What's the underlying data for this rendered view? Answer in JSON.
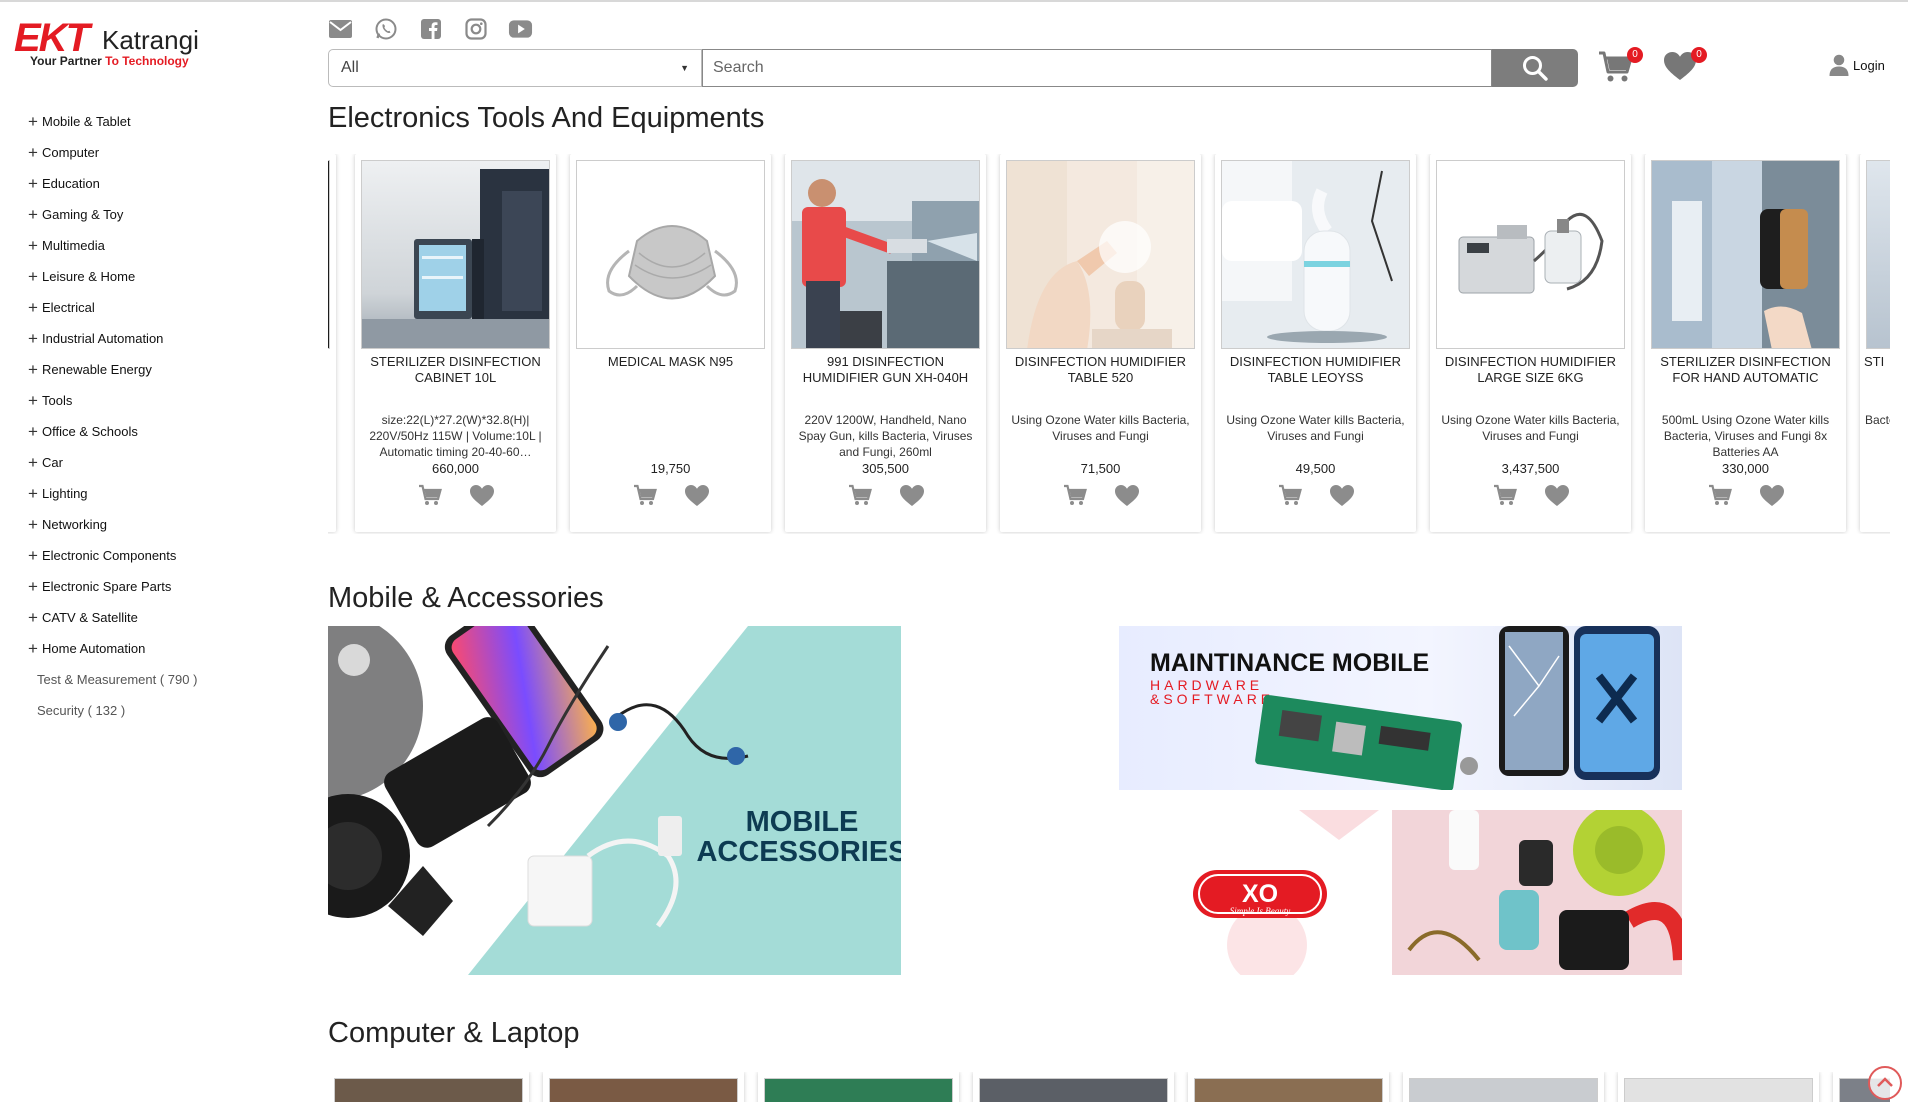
{
  "brand": {
    "logo_mark": "EKT",
    "logo_name": "Katrangi",
    "tagline_a": "Your Partner ",
    "tagline_b": "To Technology",
    "accent": "#e41b23"
  },
  "sidebar": {
    "categories": [
      {
        "label": "Mobile & Tablet"
      },
      {
        "label": "Computer"
      },
      {
        "label": "Education"
      },
      {
        "label": "Gaming & Toy"
      },
      {
        "label": "Multimedia"
      },
      {
        "label": "Leisure & Home"
      },
      {
        "label": "Electrical"
      },
      {
        "label": "Industrial Automation"
      },
      {
        "label": "Renewable Energy"
      },
      {
        "label": "Tools"
      },
      {
        "label": "Office & Schools"
      },
      {
        "label": "Car"
      },
      {
        "label": "Lighting"
      },
      {
        "label": "Networking"
      },
      {
        "label": "Electronic Components"
      },
      {
        "label": "Electronic Spare Parts"
      },
      {
        "label": "CATV & Satellite"
      },
      {
        "label": "Home Automation"
      }
    ],
    "subitems": [
      {
        "label": "Test & Measurement ( 790 )"
      },
      {
        "label": "Security ( 132 )"
      }
    ]
  },
  "header": {
    "social_icons": [
      "email-icon",
      "whatsapp-icon",
      "facebook-icon",
      "instagram-icon",
      "youtube-icon"
    ],
    "category_select": "All",
    "search_placeholder": "Search",
    "cart_count": "0",
    "wishlist_count": "0",
    "login_label": "Login"
  },
  "sections": {
    "electronics_title": "Electronics Tools And Equipments",
    "mobile_title": "Mobile & Accessories",
    "computer_title": "Computer & Laptop"
  },
  "products": [
    {
      "title": "",
      "desc": "",
      "price": ""
    },
    {
      "title": "STERILIZER DISINFECTION CABINET 10L",
      "desc": "size:22(L)*27.2(W)*32.8(H)| 220V/50Hz 115W | Volume:10L | Automatic timing 20-40-60…",
      "price": "660,000"
    },
    {
      "title": "MEDICAL MASK N95",
      "desc": "",
      "price": "19,750"
    },
    {
      "title": "991 DISINFECTION HUMIDIFIER GUN XH-040H",
      "desc": "220V 1200W, Handheld, Nano Spay Gun, kills Bacteria, Viruses and Fungi, 260ml",
      "price": "305,500"
    },
    {
      "title": "DISINFECTION HUMIDIFIER TABLE 520",
      "desc": "Using Ozone Water kills Bacteria, Viruses and Fungi",
      "price": "71,500"
    },
    {
      "title": "DISINFECTION HUMIDIFIER TABLE LEOYSS",
      "desc": "Using Ozone Water kills Bacteria, Viruses and Fungi",
      "price": "49,500"
    },
    {
      "title": "DISINFECTION HUMIDIFIER LARGE SIZE 6KG",
      "desc": "Using Ozone Water kills Bacteria, Viruses and Fungi",
      "price": "3,437,500"
    },
    {
      "title": "STERILIZER DISINFECTION FOR HAND AUTOMATIC",
      "desc": "500mL Using Ozone Water kills Bacteria, Viruses and Fungi 8x Batteries AA",
      "price": "330,000"
    },
    {
      "title": "STI",
      "desc": "Bacte",
      "price": ""
    }
  ],
  "banners": {
    "mobile_accessories_line1": "MOBILE",
    "mobile_accessories_line2": "ACCESSORIES",
    "maintenance_title": "MAINTINANCE MOBILE",
    "maintenance_sub1": "HARDWARE",
    "maintenance_sub2": "&SOFTWARE",
    "xo_logo": "XO",
    "xo_slogan": "Simple Is Beauty"
  }
}
